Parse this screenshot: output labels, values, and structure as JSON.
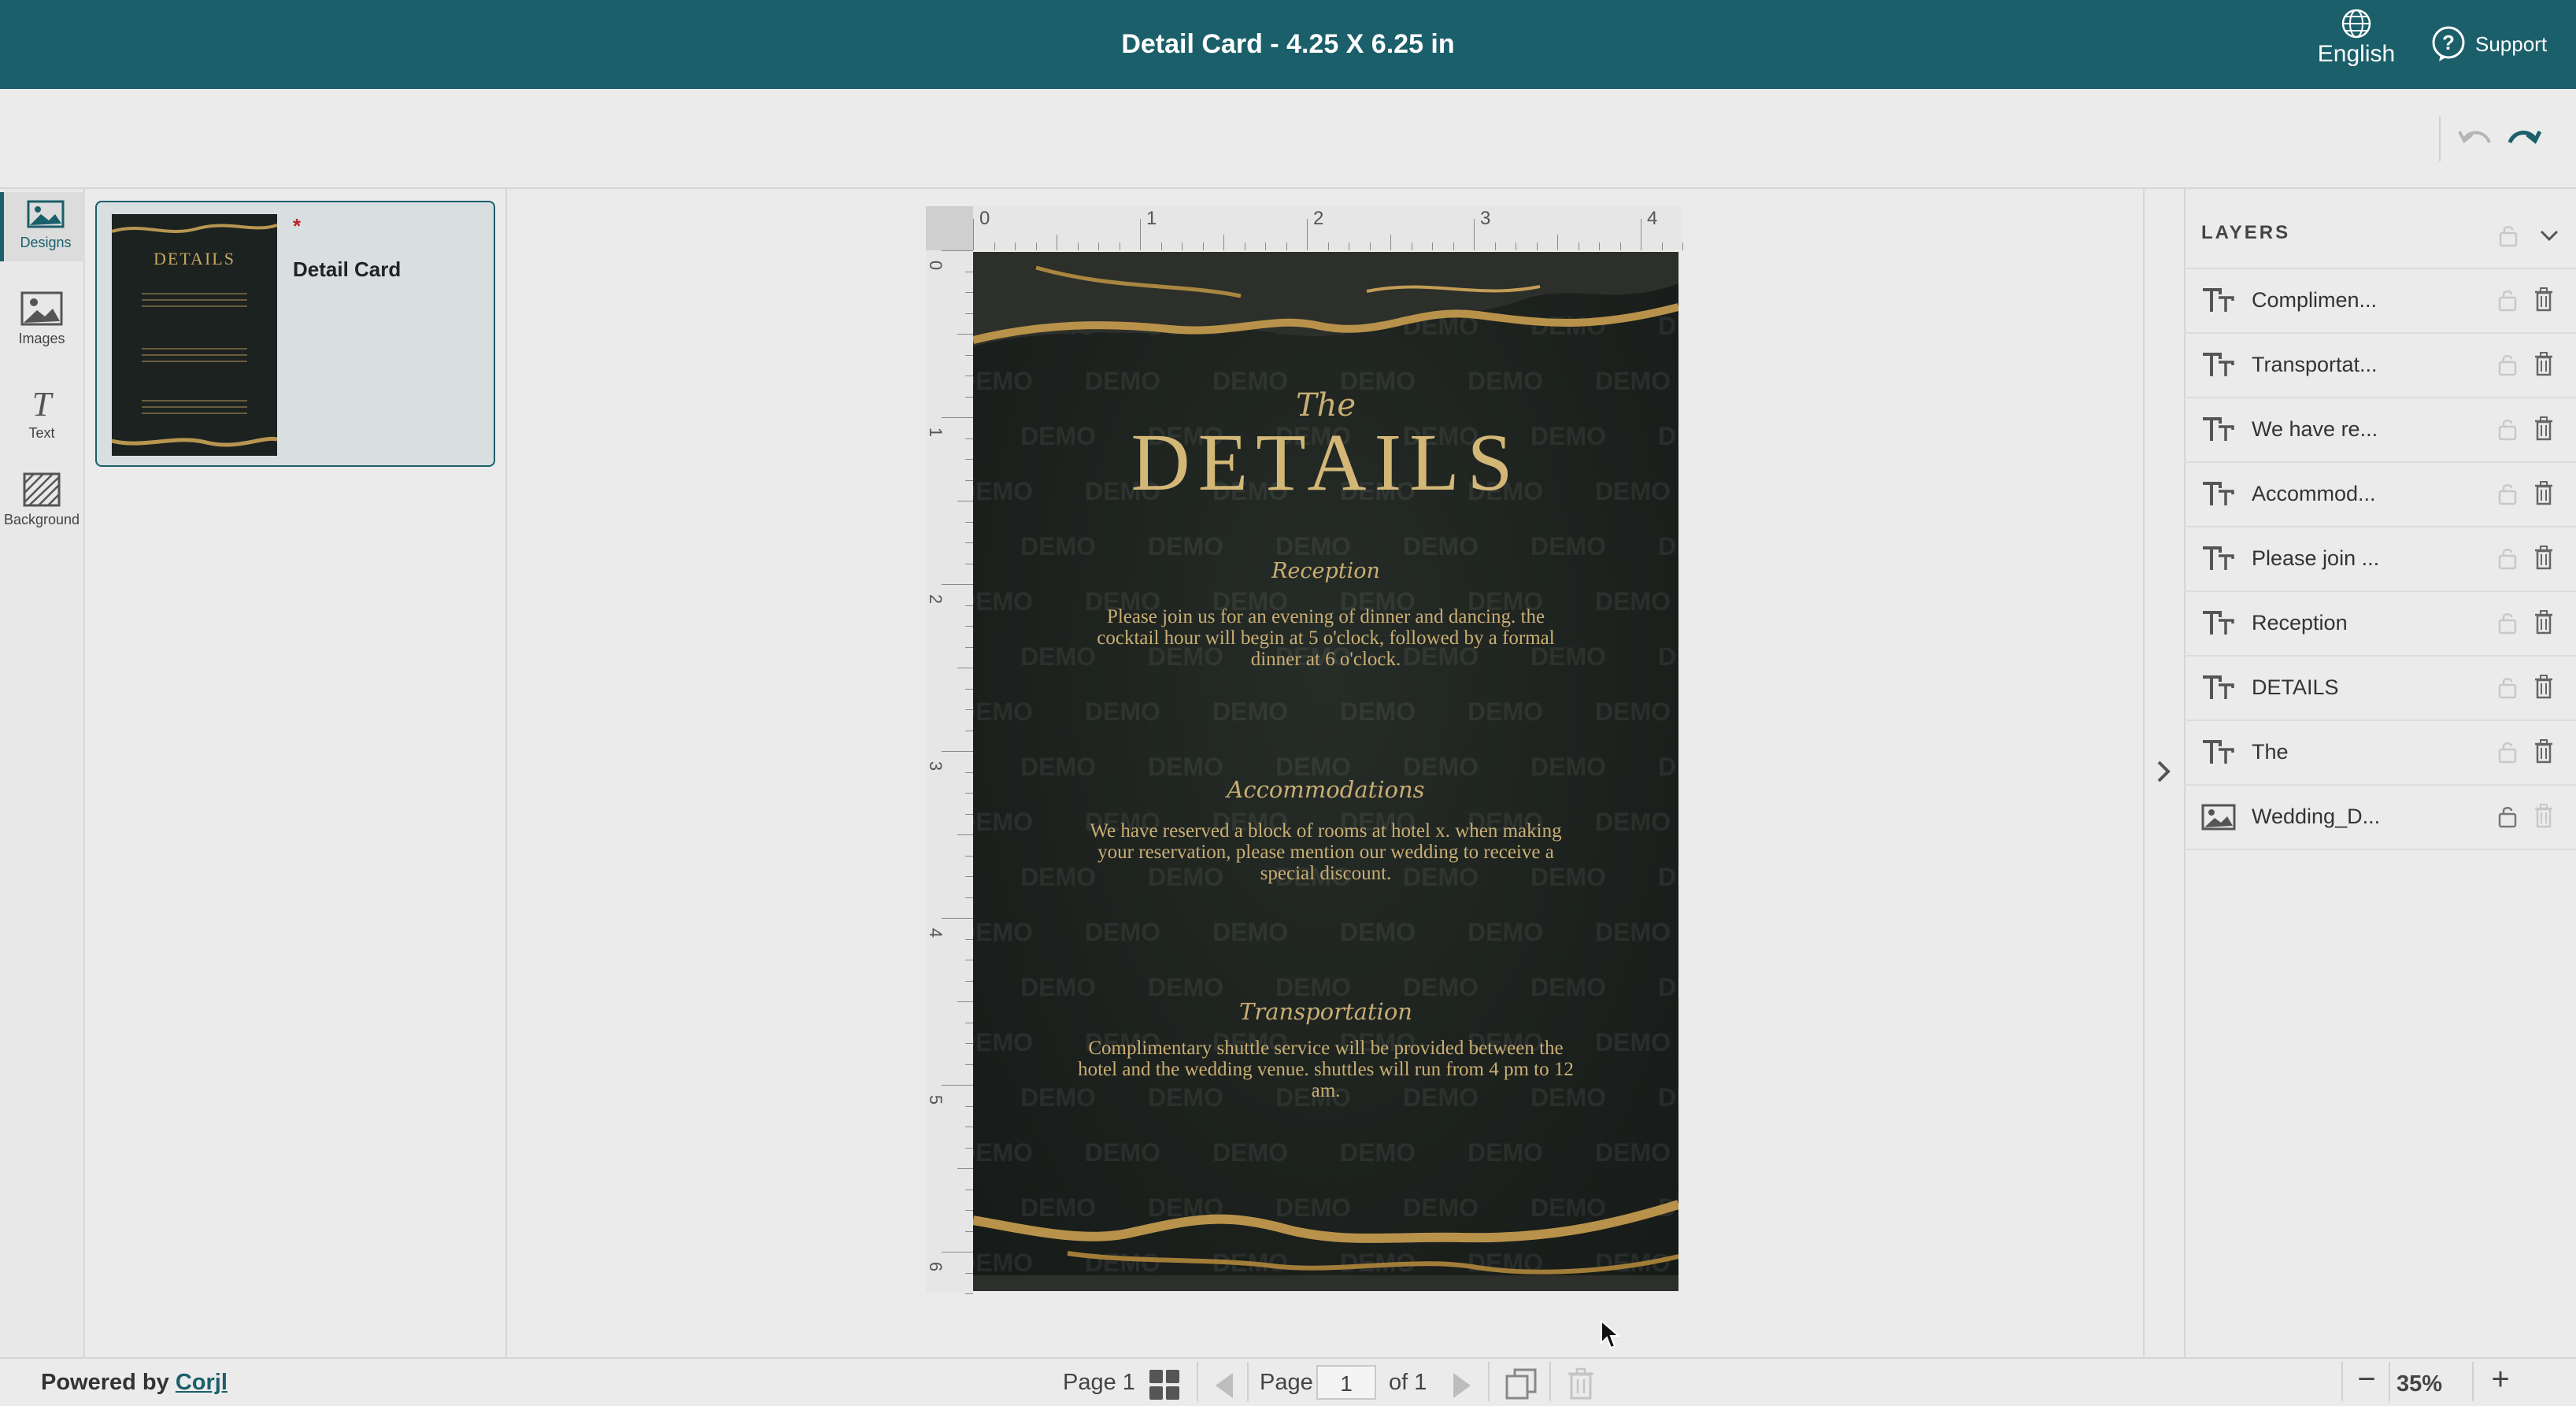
{
  "header": {
    "title": "Detail Card - 4.25 X 6.25 in",
    "language": "English",
    "support": "Support"
  },
  "rail": {
    "designs": "Designs",
    "images": "Images",
    "text": "Text",
    "background": "Background"
  },
  "designs": {
    "unsaved_marker": "*",
    "items": [
      {
        "name": "Detail Card",
        "thumb_title": "DETAILS"
      }
    ]
  },
  "ruler": {
    "top": [
      "0",
      "1",
      "2",
      "3",
      "4"
    ],
    "left": [
      "0",
      "1",
      "2",
      "3",
      "4",
      "5",
      "6"
    ]
  },
  "card": {
    "watermark": "DEMO",
    "the": "The",
    "details": "DETAILS",
    "reception_heading": "Reception",
    "reception_body": "Please join us for an evening of dinner and dancing. the cocktail hour will begin at 5 o'clock, followed by a formal dinner at 6 o'clock.",
    "accommodations_heading": "Accommodations",
    "accommodations_body": "We have reserved a block of rooms at hotel x. when making your reservation, please mention our wedding to receive a special discount.",
    "transportation_heading": "Transportation",
    "transportation_body": "Complimentary shuttle service will be provided between the hotel and the wedding venue. shuttles will run from 4 pm to 12 am."
  },
  "layers": {
    "title": "LAYERS",
    "items": [
      {
        "name": "Complimen...",
        "icon": "text-icon"
      },
      {
        "name": "Transportat...",
        "icon": "text-icon"
      },
      {
        "name": "We have re...",
        "icon": "text-icon"
      },
      {
        "name": "Accommod...",
        "icon": "text-icon"
      },
      {
        "name": "Please join ...",
        "icon": "text-icon"
      },
      {
        "name": "Reception",
        "icon": "text-icon"
      },
      {
        "name": "DETAILS",
        "icon": "text-icon"
      },
      {
        "name": "The",
        "icon": "text-icon"
      },
      {
        "name": "Wedding_D...",
        "icon": "image-icon"
      }
    ]
  },
  "footer": {
    "powered_by": "Powered by",
    "brand": "Corjl",
    "page_label": "Page 1",
    "page_word": "Page",
    "page_input": "1",
    "page_of": "of 1",
    "zoom": "35%",
    "zoom_minus": "−",
    "zoom_plus": "+"
  },
  "colors": {
    "brand": "#1b5f6a",
    "card_bg": "#1c211e",
    "gold": "#c9ae72"
  }
}
